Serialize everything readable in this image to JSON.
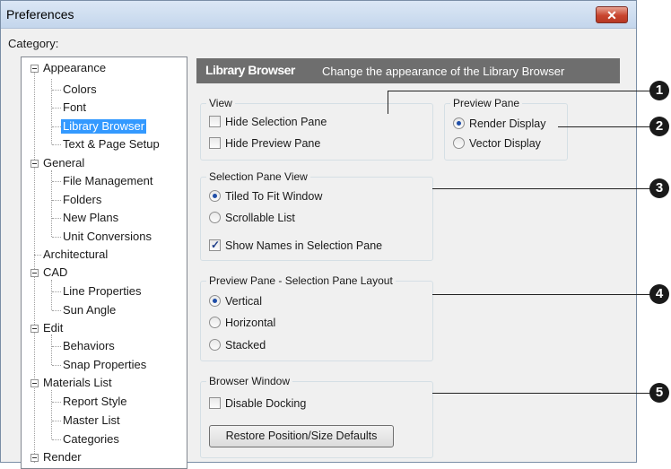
{
  "window": {
    "title": "Preferences",
    "close_glyph": "✕"
  },
  "category_label": "Category:",
  "tree": {
    "appearance": "Appearance",
    "colors": "Colors",
    "font": "Font",
    "library_browser": "Library Browser",
    "text_page_setup": "Text & Page Setup",
    "general": "General",
    "file_management": "File Management",
    "folders": "Folders",
    "new_plans": "New Plans",
    "unit_conversions": "Unit Conversions",
    "architectural": "Architectural",
    "cad": "CAD",
    "line_properties": "Line Properties",
    "sun_angle": "Sun Angle",
    "edit": "Edit",
    "behaviors": "Behaviors",
    "snap_properties": "Snap Properties",
    "materials_list": "Materials List",
    "report_style": "Report Style",
    "master_list": "Master List",
    "categories": "Categories",
    "render": "Render"
  },
  "header": {
    "title": "Library Browser",
    "subtitle": "Change the appearance of the Library Browser"
  },
  "view": {
    "label": "View",
    "hide_selection": "Hide Selection Pane",
    "hide_preview": "Hide Preview Pane"
  },
  "preview_pane": {
    "label": "Preview Pane",
    "render_display": "Render Display",
    "vector_display": "Vector Display",
    "selected": "Render Display"
  },
  "selection_pane_view": {
    "label": "Selection Pane View",
    "tiled": "Tiled To Fit Window",
    "scrollable": "Scrollable List",
    "show_names": "Show Names in Selection Pane",
    "selected": "Tiled To Fit Window"
  },
  "layout": {
    "label": "Preview Pane - Selection Pane Layout",
    "vertical": "Vertical",
    "horizontal": "Horizontal",
    "stacked": "Stacked",
    "selected": "Vertical"
  },
  "browser_window": {
    "label": "Browser Window",
    "disable_docking": "Disable Docking",
    "restore_button": "Restore Position/Size Defaults"
  },
  "callouts": [
    "1",
    "2",
    "3",
    "4",
    "5"
  ],
  "colors": {
    "header_bg": "#6e6e6e",
    "selection": "#3399ff",
    "close_button": "#c8452f"
  }
}
